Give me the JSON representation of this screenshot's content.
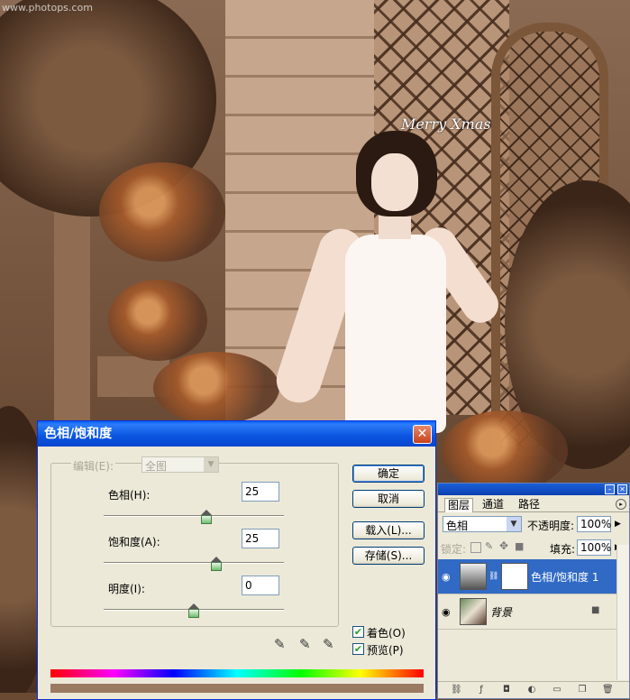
{
  "watermark": "www.photops.com",
  "sign_text": "Merry Xmas",
  "dialog": {
    "title": "色相/饱和度",
    "close_glyph": "✕",
    "edit_label": "编辑(E):",
    "edit_value": "全图",
    "hue_label": "色相(H):",
    "hue_value": "25",
    "hue_fraction": 0.5694,
    "saturation_label": "饱和度(A):",
    "saturation_value": "25",
    "saturation_fraction": 0.625,
    "lightness_label": "明度(I):",
    "lightness_value": "0",
    "lightness_fraction": 0.5,
    "ok_label": "确定",
    "cancel_label": "取消",
    "load_label": "载入(L)...",
    "save_label": "存储(S)...",
    "colorize_label": "着色(O)",
    "colorize_checked": true,
    "preview_label": "预览(P)",
    "preview_checked": true,
    "check_glyph": "✔"
  },
  "layers_panel": {
    "tabs": [
      "图层",
      "通道",
      "路径"
    ],
    "active_tab": "图层",
    "blend_mode": "色相",
    "opacity_label": "不透明度:",
    "opacity_value": "100%",
    "lock_label": "锁定:",
    "fill_label": "填充:",
    "fill_value": "100%",
    "layers": [
      {
        "name": "色相/饱和度 1",
        "selected": true,
        "type": "adjustment"
      },
      {
        "name": "背景",
        "selected": false,
        "type": "image"
      }
    ]
  },
  "colors": {
    "title_blue": "#0a54e0",
    "selected_layer": "#316ac5",
    "dialog_bg": "#ece9d8"
  }
}
